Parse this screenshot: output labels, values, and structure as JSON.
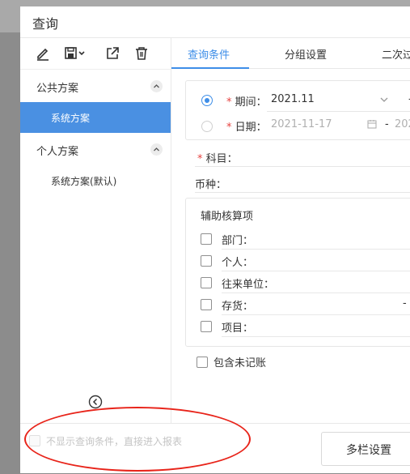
{
  "dialog": {
    "title": "查询"
  },
  "toolbar": {
    "edit_icon": "pencil-icon",
    "save_icon": "save-dropdown-icon",
    "export_icon": "export-icon",
    "delete_icon": "trash-icon"
  },
  "schemes": {
    "public": {
      "label": "公共方案",
      "items": [
        {
          "label": "系统方案",
          "selected": true
        }
      ]
    },
    "personal": {
      "label": "个人方案",
      "items": [
        {
          "label": "系统方案(默认)",
          "selected": false
        }
      ]
    }
  },
  "tabs": [
    {
      "label": "查询条件",
      "active": true
    },
    {
      "label": "分组设置",
      "active": false
    },
    {
      "label": "二次过",
      "active": false
    }
  ],
  "period": {
    "label": "期间：",
    "required_mark": "*",
    "value": "2021.11",
    "separator": "-",
    "selected": true
  },
  "date": {
    "label": "日期：",
    "required_mark": "*",
    "start": "2021-11-17",
    "separator": "-",
    "end": "202",
    "selected": false
  },
  "subject": {
    "label": "科目：",
    "required_mark": "*"
  },
  "currency": {
    "label": "币种："
  },
  "auxiliary": {
    "title": "辅助核算项",
    "items": [
      {
        "label": "部门："
      },
      {
        "label": "个人："
      },
      {
        "label": "往来单位："
      },
      {
        "label": "存货：",
        "trail": "-"
      },
      {
        "label": "项目："
      }
    ]
  },
  "include_unposted": {
    "label": "包含未记账"
  },
  "footer": {
    "skip_conditions_label": "不显示查询条件，直接进入报表",
    "multi_column_button": "多栏设置"
  },
  "colors": {
    "accent": "#3e8ee8",
    "selected_bg": "#4a90e2",
    "required": "#e64340",
    "annotation": "#e8241a"
  }
}
